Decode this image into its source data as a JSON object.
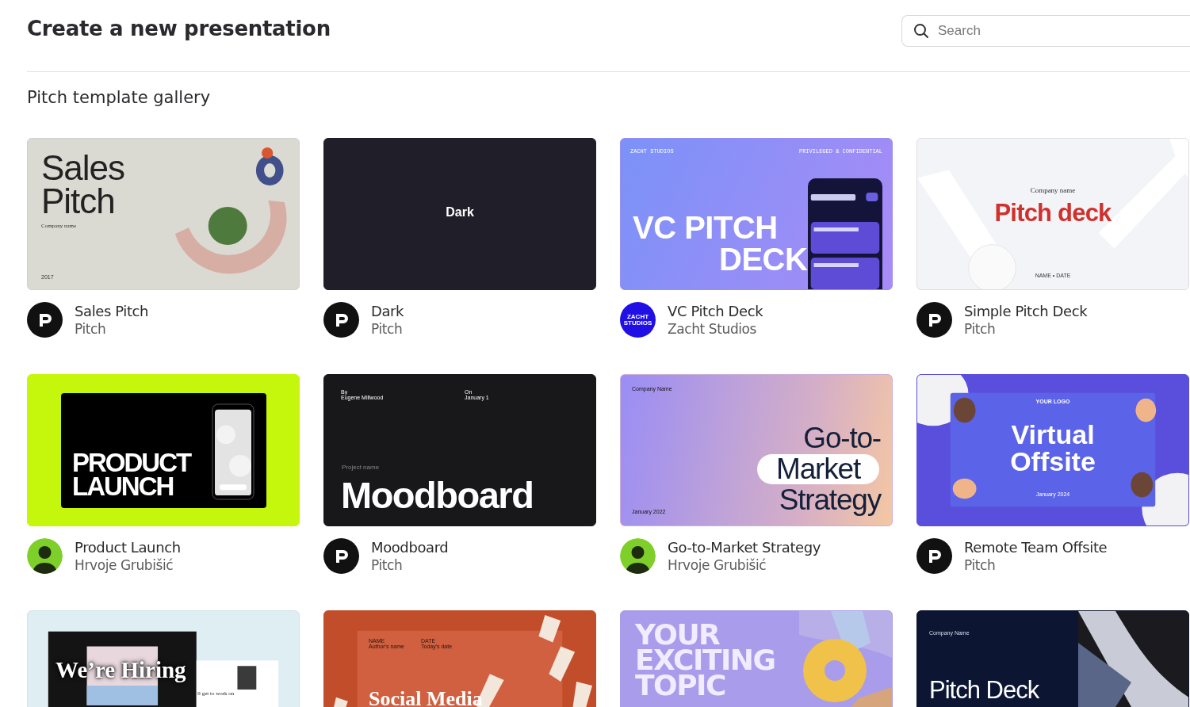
{
  "header": {
    "title": "Create a new presentation",
    "search": {
      "placeholder": "Search"
    }
  },
  "gallery": {
    "title": "Pitch template gallery",
    "templates": [
      {
        "name": "Sales Pitch",
        "author": "Pitch",
        "avatar": {
          "kind": "logo"
        },
        "slide": {
          "kind": "sales",
          "texts": [
            {
              "kind": "title",
              "text": "Sales"
            },
            {
              "kind": "title",
              "text": "Pitch"
            },
            {
              "kind": "caption",
              "text": "Company name"
            },
            {
              "kind": "footer",
              "text": "2017"
            }
          ]
        }
      },
      {
        "name": "Dark",
        "author": "Pitch",
        "avatar": {
          "kind": "logo"
        },
        "slide": {
          "kind": "dark",
          "texts": [
            {
              "kind": "title",
              "text": "Dark"
            }
          ]
        }
      },
      {
        "name": "VC Pitch Deck",
        "author": "Zacht Studios",
        "avatar": {
          "kind": "studio",
          "text": "ZACHT STUDIOS"
        },
        "slide": {
          "kind": "vc",
          "texts": [
            {
              "kind": "topleft",
              "text": "ZACHT STUDIOS"
            },
            {
              "kind": "topright",
              "text": "PRIVILEGED & CONFIDENTIAL"
            },
            {
              "kind": "title",
              "text": "VC PITCH"
            },
            {
              "kind": "title2",
              "text": "DECK"
            }
          ]
        }
      },
      {
        "name": "Simple Pitch Deck",
        "author": "Pitch",
        "avatar": {
          "kind": "logo"
        },
        "slide": {
          "kind": "simple",
          "texts": [
            {
              "kind": "overline",
              "text": "Company name"
            },
            {
              "kind": "title",
              "text": "Pitch deck"
            },
            {
              "kind": "footer",
              "text": "NAME • DATE"
            }
          ]
        }
      },
      {
        "name": "Product Launch",
        "author": "Hrvoje Grubišić",
        "avatar": {
          "kind": "person"
        },
        "slide": {
          "kind": "product",
          "texts": [
            {
              "kind": "title",
              "text": "PRODUCT"
            },
            {
              "kind": "title",
              "text": "LAUNCH"
            }
          ]
        }
      },
      {
        "name": "Moodboard",
        "author": "Pitch",
        "avatar": {
          "kind": "logo"
        },
        "slide": {
          "kind": "mood",
          "texts": [
            {
              "kind": "topleft",
              "text": "By"
            },
            {
              "kind": "topleft",
              "text": "Eugene Millwood"
            },
            {
              "kind": "topright",
              "text": "On"
            },
            {
              "kind": "topright",
              "text": "January 1"
            },
            {
              "kind": "caption",
              "text": "Project name"
            },
            {
              "kind": "title",
              "text": "Moodboard"
            }
          ]
        }
      },
      {
        "name": "Go-to-Market Strategy",
        "author": "Hrvoje Grubišić",
        "avatar": {
          "kind": "person"
        },
        "slide": {
          "kind": "gtm",
          "texts": [
            {
              "kind": "topleft",
              "text": "Company Name"
            },
            {
              "kind": "title",
              "text": "Go-to-",
              "highlight": false
            },
            {
              "kind": "title",
              "text": "Market",
              "highlight": true
            },
            {
              "kind": "title",
              "text": "Strategy",
              "highlight": false
            },
            {
              "kind": "footer",
              "text": "January 2022"
            }
          ]
        }
      },
      {
        "name": "Remote Team Offsite",
        "author": "Pitch",
        "avatar": {
          "kind": "logo"
        },
        "slide": {
          "kind": "offsite",
          "texts": [
            {
              "kind": "overline",
              "text": "YOUR LOGO"
            },
            {
              "kind": "title",
              "text": "Virtual"
            },
            {
              "kind": "title",
              "text": "Offsite"
            },
            {
              "kind": "footer",
              "text": "January 2024"
            }
          ]
        }
      },
      {
        "slide": {
          "kind": "hiring",
          "texts": [
            {
              "kind": "title",
              "text": "We’re Hiring"
            },
            {
              "kind": "caption",
              "text": "ll get to work on"
            }
          ]
        }
      },
      {
        "slide": {
          "kind": "social",
          "texts": [
            {
              "kind": "topleft",
              "text": "NAME"
            },
            {
              "kind": "topleft",
              "text": "Author's name"
            },
            {
              "kind": "topright",
              "text": "DATE"
            },
            {
              "kind": "topright",
              "text": "Today's date"
            },
            {
              "kind": "title",
              "text": "Social Media"
            }
          ]
        }
      },
      {
        "slide": {
          "kind": "topic",
          "texts": [
            {
              "kind": "title",
              "text": "YOUR"
            },
            {
              "kind": "title",
              "text": "EXCITING"
            },
            {
              "kind": "title",
              "text": "TOPIC"
            }
          ]
        }
      },
      {
        "slide": {
          "kind": "navy",
          "texts": [
            {
              "kind": "topleft",
              "text": "Company Name"
            },
            {
              "kind": "title",
              "text": "Pitch Deck"
            }
          ]
        }
      }
    ]
  }
}
